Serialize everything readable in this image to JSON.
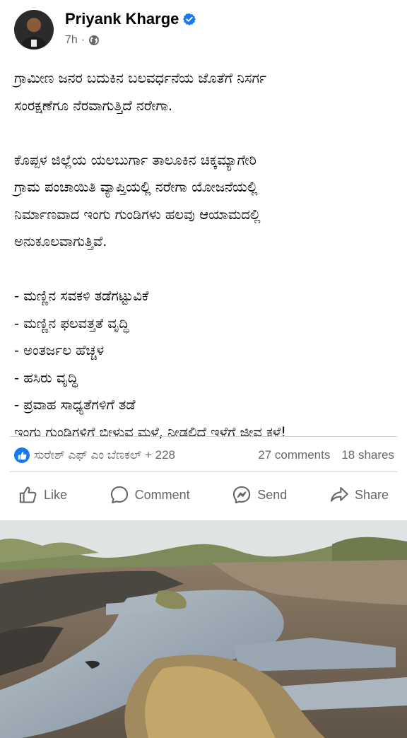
{
  "post": {
    "author": "Priyank Kharge",
    "time": "7h",
    "dot": "·",
    "text_lines": [
      "ಗ್ರಾಮೀಣ ಜನರ ಬದುಕಿನ ಬಲವರ್ಧನೆಯ ಜೊತೆಗೆ ನಿಸರ್ಗ",
      "ಸಂರಕ್ಷಣೆಗೂ ನೆರವಾಗುತ್ತಿದೆ ನರೇಗಾ.",
      "ಕೊಪ್ಪಳ ಜಿಲ್ಲೆಯ ಯಲಬುರ್ಗಾ ತಾಲೂಕಿನ ಚಿಕ್ಕಮ್ಯಾಗೇರಿ",
      "ಗ್ರಾಮ ಪಂಚಾಯಿತಿ ವ್ಯಾಪ್ತಿಯಲ್ಲಿ ನರೇಗಾ ಯೋಜನೆಯಲ್ಲಿ",
      "ನಿರ್ಮಾಣವಾದ ಇಂಗು ಗುಂಡಿಗಳು ಹಲವು ಆಯಾಮದಲ್ಲಿ",
      "ಅನುಕೂಲವಾಗುತ್ತಿವೆ.",
      "- ಮಣ್ಣಿನ ಸವಕಳಿ ತಡೆಗಟ್ಟುವಿಕೆ",
      "- ಮಣ್ಣಿನ ಫಲವತ್ತತೆ ವೃದ್ಧಿ",
      "- ಅಂತರ್ಜಲ ಹೆಚ್ಚಳ",
      "- ಹಸಿರು ವೃದ್ಧಿ",
      "- ಪ್ರವಾಹ ಸಾಧ್ಯತೆಗಳಿಗೆ ತಡೆ",
      "ಇಂಗು ಗುಂಡಿಗಳಿಗೆ ಬೀಳುವ ಮಳೆ, ನೀಡಲಿದೆ ಇಳೆಗೆ ಜೀವ ಕಳೆ!"
    ]
  },
  "stats": {
    "reactors": "ಸುರೇಶ್ ಎಫ್ ಎಂ ಬೆಣಕಲ್ + 228",
    "comments": "27 comments",
    "shares": "18 shares"
  },
  "actions": {
    "like": "Like",
    "comment": "Comment",
    "send": "Send",
    "share": "Share"
  },
  "colors": {
    "brand_blue": "#1877f2",
    "secondary_text": "#65676b",
    "divider": "#ced0d4"
  },
  "icons": {
    "verified": "verified-badge-icon",
    "audience": "globe-icon",
    "like_reaction": "thumbs-up-icon",
    "like": "like-icon",
    "comment": "comment-icon",
    "send": "messenger-icon",
    "share": "share-arrow-icon"
  }
}
